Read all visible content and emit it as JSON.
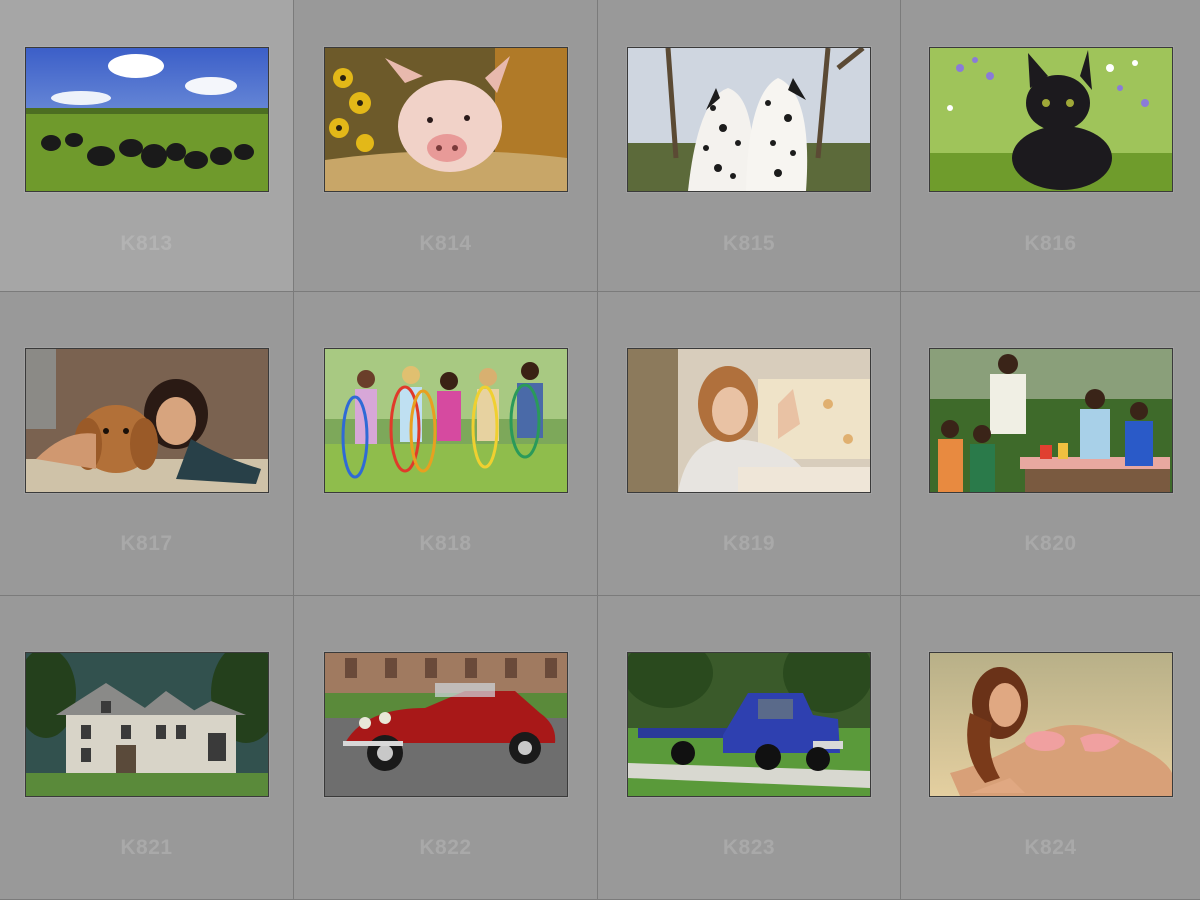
{
  "grid": {
    "items": [
      {
        "label": "K813",
        "subject": "cattle-grazing",
        "selected": true
      },
      {
        "label": "K814",
        "subject": "pig-in-basket"
      },
      {
        "label": "K815",
        "subject": "dalmatian-puppies"
      },
      {
        "label": "K816",
        "subject": "black-kitten"
      },
      {
        "label": "K817",
        "subject": "girl-with-spaniel"
      },
      {
        "label": "K818",
        "subject": "children-hula-hoops"
      },
      {
        "label": "K819",
        "subject": "girl-praying"
      },
      {
        "label": "K820",
        "subject": "family-picnic"
      },
      {
        "label": "K821",
        "subject": "suburban-house"
      },
      {
        "label": "K822",
        "subject": "vintage-red-car"
      },
      {
        "label": "K823",
        "subject": "blue-flatbed-truck"
      },
      {
        "label": "K824",
        "subject": "woman-on-beach"
      }
    ]
  },
  "colors": {
    "cell_background": "#999999",
    "selected_background": "#a6a6a6",
    "label": "#a9a9a9",
    "divider": "#7b7b7b"
  }
}
